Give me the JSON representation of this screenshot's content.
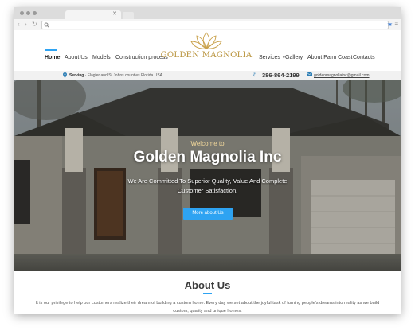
{
  "site": {
    "nav": {
      "items_left": [
        "Home",
        "About Us",
        "Models",
        "Construction process"
      ],
      "logo_text": "GOLDEN MAGNOLIA",
      "items_right": [
        "Services",
        "Gallery",
        "About Palm Coast",
        "Contacts"
      ]
    },
    "infobar": {
      "serving_label": "Serving",
      "serving_area": "· Flagler and St Johns counties Florida USA",
      "phone": "386-864-2199",
      "email": "goldenmagnoliainc@gmail.com"
    },
    "hero": {
      "welcome": "Welcome to",
      "title": "Golden Magnolia Inc",
      "subtitle": "We Are Committed To Superior Quality, Value And Complete Customer Satisfaction.",
      "button": "More about Us"
    },
    "about": {
      "title": "About Us",
      "text": "It is our privilege to help our customers realize their dream of building a custom home. Every day we set about the joyful task of turning people's dreams into reality as we build custom, quality and unique homes."
    }
  },
  "colors": {
    "accent": "#2ea3f2",
    "gold": "#b8923a"
  },
  "icons": [
    "chevron-left-icon",
    "chevron-right-icon",
    "reload-icon",
    "search-icon",
    "star-icon",
    "menu-icon",
    "location-icon",
    "phone-icon",
    "envelope-icon",
    "magnolia-logo-icon"
  ]
}
